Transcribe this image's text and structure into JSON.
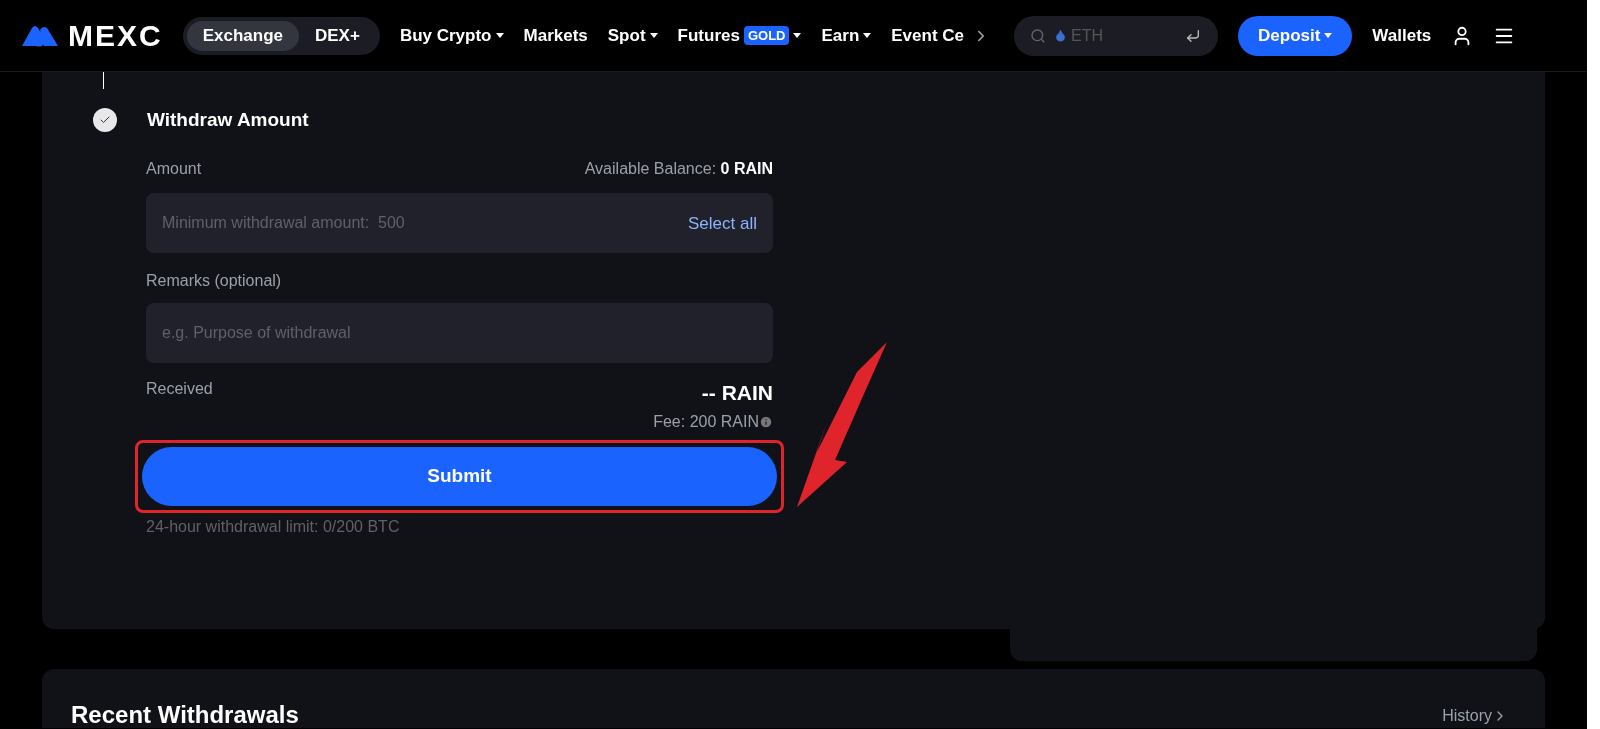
{
  "header": {
    "logo": "MEXC",
    "mode_toggle": [
      {
        "label": "Exchange",
        "selected": true
      },
      {
        "label": "DEX+",
        "selected": false
      }
    ],
    "nav": [
      {
        "label": "Buy Crypto",
        "dropdown": true
      },
      {
        "label": "Markets",
        "dropdown": false
      },
      {
        "label": "Spot",
        "dropdown": true
      },
      {
        "label": "Futures",
        "badge": "GOLD",
        "dropdown": true
      },
      {
        "label": "Earn",
        "dropdown": true
      },
      {
        "label": "Event Ce",
        "dropdown": false
      }
    ],
    "search": {
      "placeholder": "ETH"
    },
    "deposit": "Deposit",
    "wallets": "Wallets"
  },
  "step": {
    "title": "Withdraw Amount",
    "done": true
  },
  "amount": {
    "label": "Amount",
    "balance_label": "Available Balance:",
    "balance": "0 RAIN",
    "placeholder": "Minimum withdrawal amount:  500",
    "select_all": "Select all"
  },
  "remarks": {
    "label": "Remarks (optional)",
    "placeholder": "e.g. Purpose of withdrawal"
  },
  "received": {
    "label": "Received",
    "value": "-- RAIN",
    "fee": "Fee: 200 RAIN"
  },
  "submit": "Submit",
  "limit": "24-hour withdrawal limit: 0/200 BTC",
  "recent": {
    "title": "Recent Withdrawals",
    "history": "History"
  }
}
